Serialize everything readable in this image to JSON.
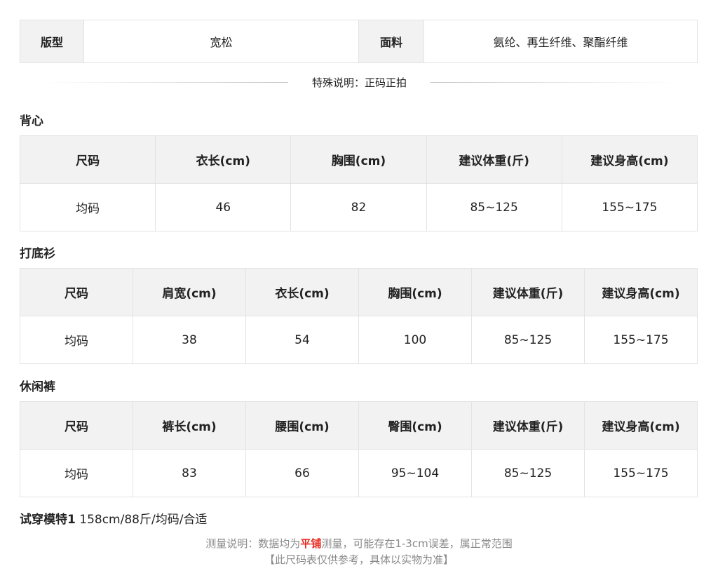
{
  "info": {
    "fit_label": "版型",
    "fit_value": "宽松",
    "fabric_label": "面料",
    "fabric_value": "氨纶、再生纤维、聚酯纤维"
  },
  "special_note": "特殊说明：正码正拍",
  "sections": [
    {
      "title": "背心",
      "headers": [
        "尺码",
        "衣长(cm)",
        "胸围(cm)",
        "建议体重(斤)",
        "建议身高(cm)"
      ],
      "row": [
        "均码",
        "46",
        "82",
        "85~125",
        "155~175"
      ]
    },
    {
      "title": "打底衫",
      "headers": [
        "尺码",
        "肩宽(cm)",
        "衣长(cm)",
        "胸围(cm)",
        "建议体重(斤)",
        "建议身高(cm)"
      ],
      "row": [
        "均码",
        "38",
        "54",
        "100",
        "85~125",
        "155~175"
      ]
    },
    {
      "title": "休闲裤",
      "headers": [
        "尺码",
        "裤长(cm)",
        "腰围(cm)",
        "臀围(cm)",
        "建议体重(斤)",
        "建议身高(cm)"
      ],
      "row": [
        "均码",
        "83",
        "66",
        "95~104",
        "85~125",
        "155~175"
      ]
    }
  ],
  "model": {
    "label": "试穿模特1",
    "value": "158cm/88斤/均码/合适"
  },
  "footer": {
    "prefix": "测量说明：数据均为",
    "highlight": "平铺",
    "suffix": "测量，可能存在1-3cm误差，属正常范围",
    "line2": "【此尺码表仅供参考，具体以实物为准】"
  },
  "colors": {
    "header_bg": "#f2f2f2",
    "border": "#e3e3e3",
    "highlight": "#e8281e",
    "footer_text": "#8a8a8a"
  }
}
